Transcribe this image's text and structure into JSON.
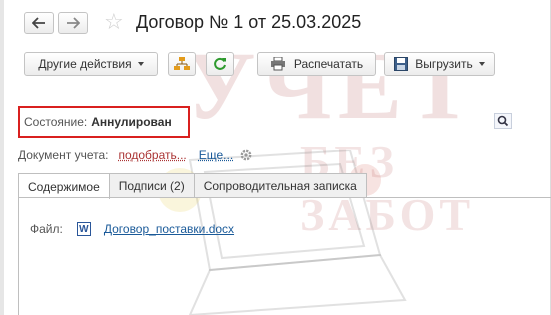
{
  "window": {
    "title": "Договор № 1 от 25.03.2025"
  },
  "toolbar": {
    "other_actions_label": "Другие действия",
    "print_label": "Распечатать",
    "export_label": "Выгрузить"
  },
  "state": {
    "label": "Состояние:",
    "value": "Аннулирован"
  },
  "accounting_document": {
    "label": "Документ учета:",
    "pick_link": "подобрать...",
    "more_link": "Еще..."
  },
  "tabs": [
    {
      "label": "Содержимое",
      "active": true
    },
    {
      "label": "Подписи (2)",
      "active": false
    },
    {
      "label": "Сопроводительная записка",
      "active": false
    }
  ],
  "content": {
    "file_label": "Файл:",
    "file_icon_letter": "W",
    "file_name": "Договор_поставки.docx"
  },
  "watermark": {
    "line1": "УЧЕТ",
    "line2": "БЕЗ ЗАБОТ"
  },
  "colors": {
    "state_border": "#d9201f",
    "link": "#1a5a99",
    "pick_link": "#a33333",
    "refresh_icon": "#2e9a2e",
    "structure_icon": "#d08a10"
  },
  "icons": [
    "back-arrow-icon",
    "forward-arrow-icon",
    "star-icon",
    "structure-icon",
    "refresh-icon",
    "printer-icon",
    "floppy-disk-icon",
    "search-icon",
    "gear-icon",
    "word-icon"
  ]
}
